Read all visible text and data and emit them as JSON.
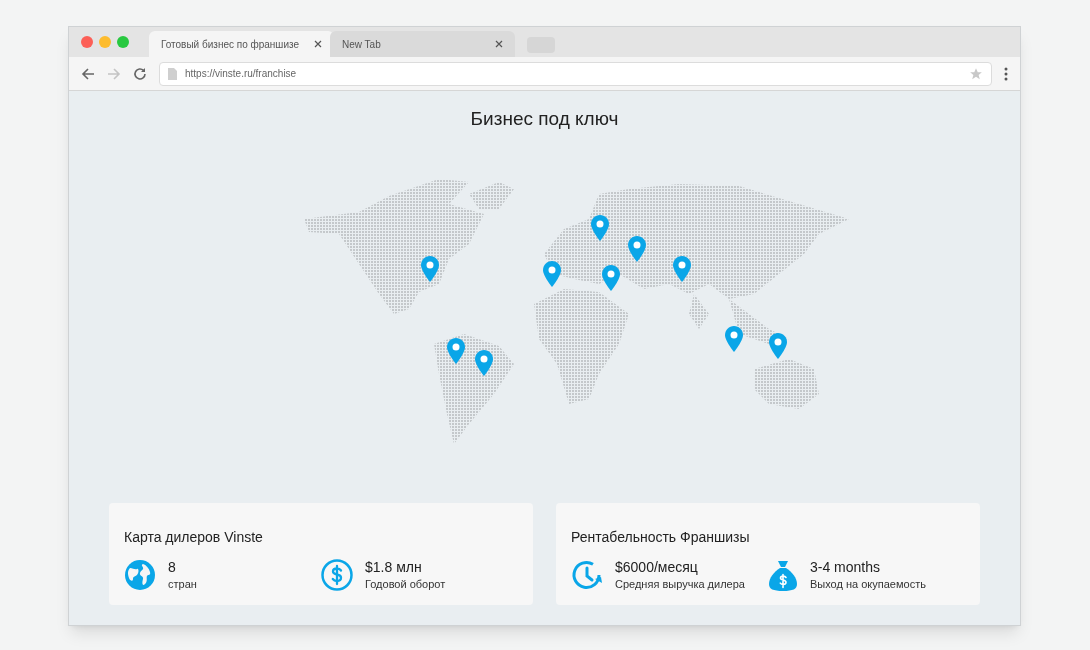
{
  "tabs": [
    {
      "label": "Готовый бизнес по франшизе",
      "selected": true
    },
    {
      "label": "New Tab",
      "selected": false
    }
  ],
  "address_bar": {
    "url": "https://vinste.ru/franchise"
  },
  "page": {
    "title": "Бизнес под ключ"
  },
  "cards": [
    {
      "title": "Карта дилеров Vinste",
      "stats": [
        {
          "kind": "globe",
          "value": "8",
          "label": "стран"
        },
        {
          "kind": "dollar",
          "value": "$1.8 млн",
          "label": "Годовой оборот"
        }
      ]
    },
    {
      "title": "Рентабельность Франшизы",
      "stats": [
        {
          "kind": "clock",
          "value": "$6000/месяц",
          "label": "Средняя выручка дилера"
        },
        {
          "kind": "moneybag",
          "value": "3-4 months",
          "label": "Выход на окупаемость"
        }
      ]
    }
  ]
}
